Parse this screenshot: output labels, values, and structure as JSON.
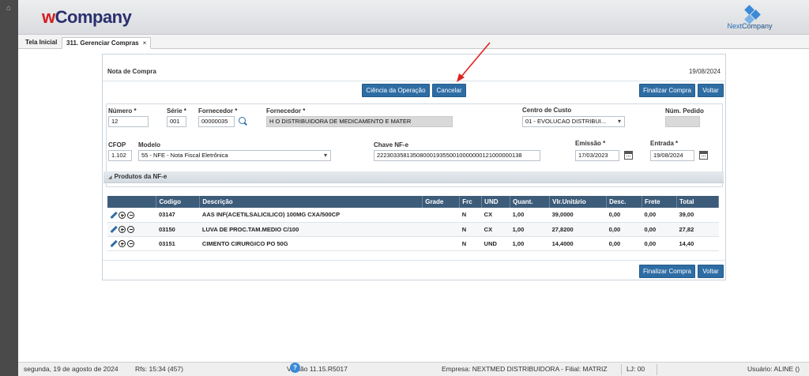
{
  "header": {
    "logo_w": "w",
    "logo_company": "Company",
    "brand_next": "Next",
    "brand_company": "Company"
  },
  "tabs": [
    {
      "label": "Tela Inicial"
    },
    {
      "label": "311. Gerenciar Compras",
      "close": "×"
    }
  ],
  "panel": {
    "title": "Nota de Compra",
    "date": "19/08/2024",
    "buttons": {
      "ciencia": "Ciência da Operação",
      "cancelar": "Cancelar",
      "finalizar": "Finalizar Compra",
      "voltar": "Voltar"
    }
  },
  "form": {
    "numero": {
      "label": "Número *",
      "value": "12"
    },
    "serie": {
      "label": "Série *",
      "value": "001"
    },
    "fornecedor_cod": {
      "label": "Fornecedor *",
      "value": "00000035"
    },
    "fornecedor_nome": {
      "label": "Fornecedor *",
      "value": "H O DISTRIBUIDORA DE MEDICAMENTO E MATER"
    },
    "centro_custo": {
      "label": "Centro de Custo",
      "value": "01 - EVOLUCAO DISTRIBUI..."
    },
    "num_pedido": {
      "label": "Núm. Pedido",
      "value": ""
    },
    "cfop": {
      "label": "CFOP",
      "value": "1.102"
    },
    "modelo": {
      "label": "Modelo",
      "value": "55 - NFE - Nota Fiscal Eletrônica"
    },
    "chave": {
      "label": "Chave NF-e",
      "value": "22230335813508000193550010000000121000000138"
    },
    "emissao": {
      "label": "Emissão *",
      "value": "17/03/2023"
    },
    "entrada": {
      "label": "Entrada *",
      "value": "19/08/2024"
    }
  },
  "produtos": {
    "title": "Produtos da NF-e",
    "columns": [
      "Codigo",
      "Descrição",
      "Grade",
      "Frc",
      "UND",
      "Quant.",
      "Vlr.Unitário",
      "Desc.",
      "Frete",
      "Total"
    ],
    "rows": [
      {
        "codigo": "03147",
        "descricao": "AAS INF(ACETILSALICILICO) 100MG CXA/500CP",
        "grade": "",
        "frc": "N",
        "und": "CX",
        "quant": "1,00",
        "vlr": "39,0000",
        "desc": "0,00",
        "frete": "0,00",
        "total": "39,00"
      },
      {
        "codigo": "03150",
        "descricao": "LUVA DE PROC.TAM.MEDIO C/100",
        "grade": "",
        "frc": "N",
        "und": "CX",
        "quant": "1,00",
        "vlr": "27,8200",
        "desc": "0,00",
        "frete": "0,00",
        "total": "27,82"
      },
      {
        "codigo": "03151",
        "descricao": "CIMENTO CIRURGICO PO 50G",
        "grade": "",
        "frc": "N",
        "und": "UND",
        "quant": "1,00",
        "vlr": "14,4000",
        "desc": "0,00",
        "frete": "0,00",
        "total": "14,40"
      }
    ]
  },
  "status": {
    "date": "segunda, 19 de agosto de 2024",
    "rfs": "Rfs: 15:34 (457)",
    "version": "Versão 11.15.R5017",
    "help": "?",
    "empresa": "Empresa: NEXTMED DISTRIBUIDORA - Filial: MATRIZ",
    "lj": "LJ: 00",
    "usuario": "Usuário: ALINE ()"
  },
  "colors": {
    "primary_button": "#2e6da4",
    "grid_header": "#3d5c7a",
    "logo_red": "#d21e1e",
    "logo_navy": "#2a2f6e",
    "arrow": "#e02020"
  }
}
